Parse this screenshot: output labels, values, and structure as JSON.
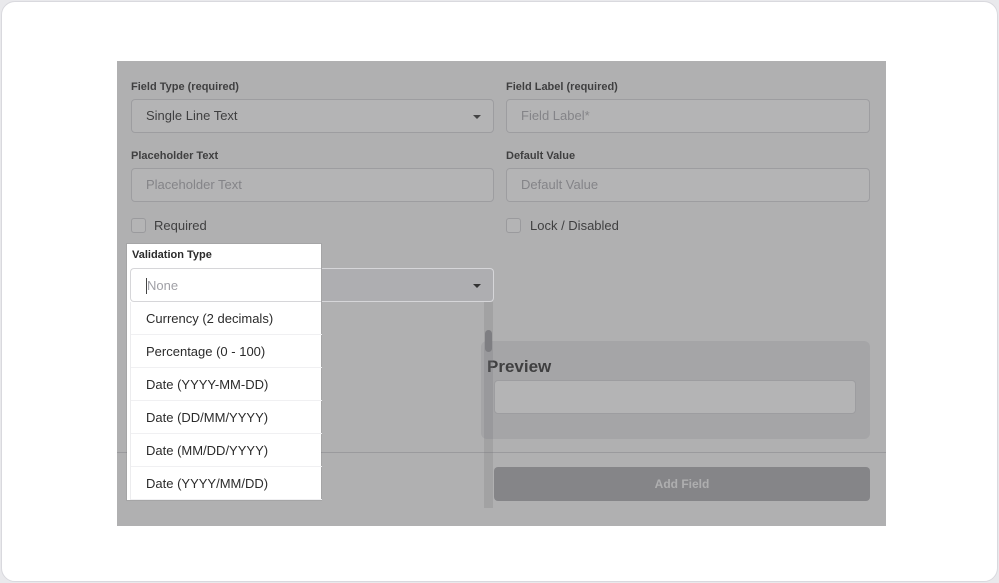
{
  "form": {
    "field_type": {
      "label": "Field Type (required)",
      "value": "Single Line Text"
    },
    "field_label": {
      "label": "Field Label (required)",
      "placeholder": "Field Label*"
    },
    "placeholder_text": {
      "label": "Placeholder Text",
      "placeholder": "Placeholder Text"
    },
    "default_value": {
      "label": "Default Value",
      "placeholder": "Default Value"
    },
    "required": {
      "label": "Required",
      "checked": false
    },
    "lock_disabled": {
      "label": "Lock / Disabled",
      "checked": false
    },
    "validation_type": {
      "label": "Validation Type",
      "value": "None",
      "options": [
        "Currency (2 decimals)",
        "Percentage (0 - 100)",
        "Date (YYYY-MM-DD)",
        "Date (DD/MM/YYYY)",
        "Date (MM/DD/YYYY)",
        "Date (YYYY/MM/DD)"
      ]
    }
  },
  "preview": {
    "title": "Preview"
  },
  "actions": {
    "add_field": "Add Field"
  },
  "colors": {
    "overlay": "#58585c",
    "button_disabled": "#a9a9ae"
  }
}
